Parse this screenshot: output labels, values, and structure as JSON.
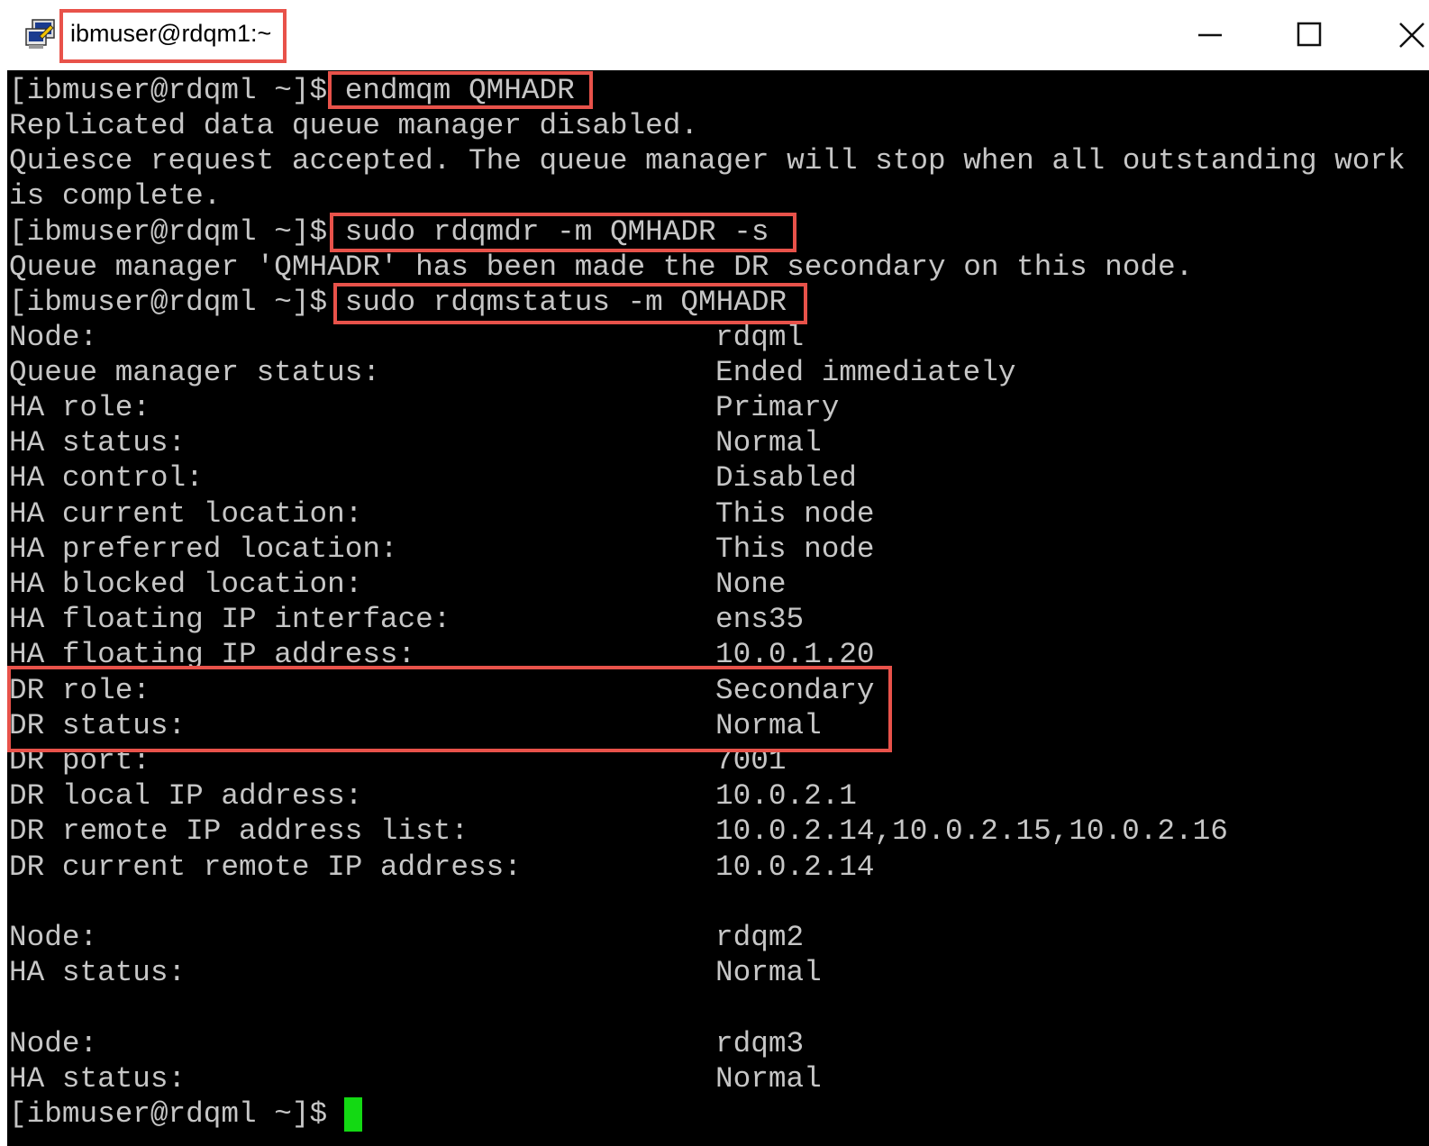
{
  "window": {
    "title": "ibmuser@rdqm1:~",
    "icon": "putty-terminal-icon",
    "buttons": {
      "minimize_icon": "minimize-icon",
      "maximize_icon": "maximize-icon",
      "close_icon": "close-icon"
    }
  },
  "terminal": {
    "prompt": "[ibmuser@rdqml ~]$ ",
    "commands": {
      "cmd1": "endmqm QMHADR",
      "cmd2": "sudo rdqmdr -m QMHADR -s",
      "cmd3": "sudo rdqmstatus -m QMHADR"
    },
    "output": {
      "o1": "Replicated data queue manager disabled.",
      "o2": "Quiesce request accepted. The queue manager will stop when all outstanding work",
      "o3": "is complete.",
      "o4": "Queue manager 'QMHADR' has been made the DR secondary on this node."
    },
    "status_node1": [
      {
        "label": "Node:",
        "value": "rdqml"
      },
      {
        "label": "Queue manager status:",
        "value": "Ended immediately"
      },
      {
        "label": "HA role:",
        "value": "Primary"
      },
      {
        "label": "HA status:",
        "value": "Normal"
      },
      {
        "label": "HA control:",
        "value": "Disabled"
      },
      {
        "label": "HA current location:",
        "value": "This node"
      },
      {
        "label": "HA preferred location:",
        "value": "This node"
      },
      {
        "label": "HA blocked location:",
        "value": "None"
      },
      {
        "label": "HA floating IP interface:",
        "value": "ens35"
      },
      {
        "label": "HA floating IP address:",
        "value": "10.0.1.20"
      },
      {
        "label": "DR role:",
        "value": "Secondary"
      },
      {
        "label": "DR status:",
        "value": "Normal"
      },
      {
        "label": "DR port:",
        "value": "7001"
      },
      {
        "label": "DR local IP address:",
        "value": "10.0.2.1"
      },
      {
        "label": "DR remote IP address list:",
        "value": "10.0.2.14,10.0.2.15,10.0.2.16"
      },
      {
        "label": "DR current remote IP address:",
        "value": "10.0.2.14"
      }
    ],
    "status_node2": [
      {
        "label": "Node:",
        "value": "rdqm2"
      },
      {
        "label": "HA status:",
        "value": "Normal"
      }
    ],
    "status_node3": [
      {
        "label": "Node:",
        "value": "rdqm3"
      },
      {
        "label": "HA status:",
        "value": "Normal"
      }
    ]
  },
  "colors": {
    "terminal_bg": "#000000",
    "terminal_fg": "#c6c6c6",
    "cursor": "#13d913",
    "highlight": "#e8524a"
  }
}
